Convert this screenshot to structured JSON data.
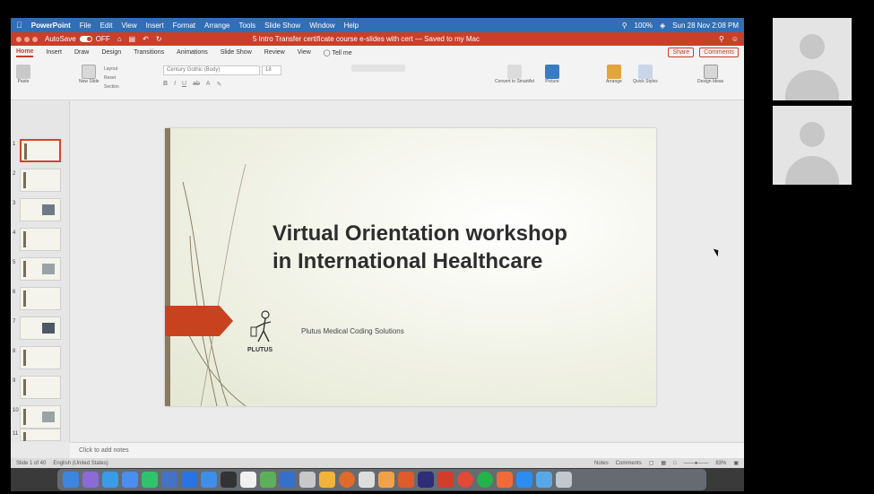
{
  "menubar": {
    "app": "PowerPoint",
    "items": [
      "File",
      "Edit",
      "View",
      "Insert",
      "Format",
      "Arrange",
      "Tools",
      "Slide Show",
      "Window",
      "Help"
    ],
    "battery": "100%",
    "datetime": "Sun 28 Nov 2:08 PM"
  },
  "titlebar": {
    "autosave": "AutoSave",
    "autosave_state": "OFF",
    "doc_title": "5 Intro Transfer certificate course e-slides with cert — Saved to my Mac"
  },
  "tabs": {
    "items": [
      "Home",
      "Insert",
      "Draw",
      "Design",
      "Transitions",
      "Animations",
      "Slide Show",
      "Review",
      "View"
    ],
    "active": "Home",
    "tell_me": "Tell me",
    "share": "Share",
    "comments": "Comments"
  },
  "ribbon": {
    "paste": "Paste",
    "new_slide": "New Slide",
    "layout": "Layout",
    "reset": "Reset",
    "section": "Section",
    "font_name": "Century Gothic (Body)",
    "font_size": "18",
    "convert_smartart": "Convert to SmartArt",
    "picture": "Picture",
    "arrange": "Arrange",
    "quick_styles": "Quick Styles",
    "design_ideas": "Design Ideas"
  },
  "thumbnails": [
    "1",
    "2",
    "3",
    "4",
    "5",
    "6",
    "7",
    "8",
    "9",
    "10",
    "11"
  ],
  "slide": {
    "title_line1": "Virtual Orientation workshop",
    "title_line2": "in International Healthcare",
    "company": "Plutus Medical Coding Solutions",
    "logo": "PLUTUS"
  },
  "notes": {
    "placeholder": "Click to add notes"
  },
  "statusbar": {
    "slide_info": "Slide 1 of 40",
    "language": "English (United States)",
    "notes": "Notes",
    "comments": "Comments",
    "zoom": "83%"
  },
  "colors": {
    "accent": "#c8402a",
    "menubar": "#2f6fb6",
    "slide_arrow": "#c9421f"
  }
}
